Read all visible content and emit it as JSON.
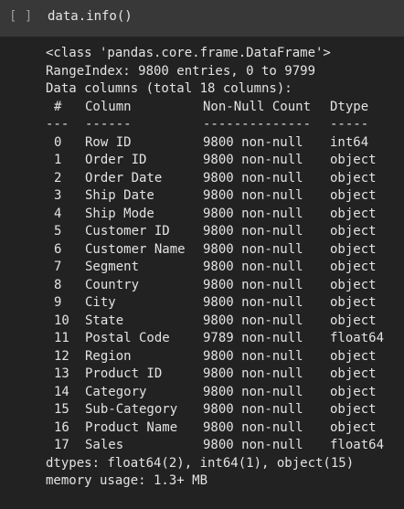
{
  "cell": {
    "prompt": "[ ]",
    "code": "data.info()"
  },
  "output": {
    "class_line": "<class 'pandas.core.frame.DataFrame'>",
    "range_line": "RangeIndex: 9800 entries, 0 to 9799",
    "columns_line": "Data columns (total 18 columns):",
    "header": {
      "num": "#",
      "column": "Column",
      "count": "Non-Null Count",
      "dtype": "Dtype"
    },
    "separator": {
      "num": "---",
      "column": "------",
      "count": "--------------",
      "dtype": "-----"
    },
    "rows": [
      {
        "num": "0",
        "column": "Row ID",
        "count": "9800 non-null",
        "dtype": "int64"
      },
      {
        "num": "1",
        "column": "Order ID",
        "count": "9800 non-null",
        "dtype": "object"
      },
      {
        "num": "2",
        "column": "Order Date",
        "count": "9800 non-null",
        "dtype": "object"
      },
      {
        "num": "3",
        "column": "Ship Date",
        "count": "9800 non-null",
        "dtype": "object"
      },
      {
        "num": "4",
        "column": "Ship Mode",
        "count": "9800 non-null",
        "dtype": "object"
      },
      {
        "num": "5",
        "column": "Customer ID",
        "count": "9800 non-null",
        "dtype": "object"
      },
      {
        "num": "6",
        "column": "Customer Name",
        "count": "9800 non-null",
        "dtype": "object"
      },
      {
        "num": "7",
        "column": "Segment",
        "count": "9800 non-null",
        "dtype": "object"
      },
      {
        "num": "8",
        "column": "Country",
        "count": "9800 non-null",
        "dtype": "object"
      },
      {
        "num": "9",
        "column": "City",
        "count": "9800 non-null",
        "dtype": "object"
      },
      {
        "num": "10",
        "column": "State",
        "count": "9800 non-null",
        "dtype": "object"
      },
      {
        "num": "11",
        "column": "Postal Code",
        "count": "9789 non-null",
        "dtype": "float64"
      },
      {
        "num": "12",
        "column": "Region",
        "count": "9800 non-null",
        "dtype": "object"
      },
      {
        "num": "13",
        "column": "Product ID",
        "count": "9800 non-null",
        "dtype": "object"
      },
      {
        "num": "14",
        "column": "Category",
        "count": "9800 non-null",
        "dtype": "object"
      },
      {
        "num": "15",
        "column": "Sub-Category",
        "count": "9800 non-null",
        "dtype": "object"
      },
      {
        "num": "16",
        "column": "Product Name",
        "count": "9800 non-null",
        "dtype": "object"
      },
      {
        "num": "17",
        "column": "Sales",
        "count": "9800 non-null",
        "dtype": "float64"
      }
    ],
    "dtypes_line": "dtypes: float64(2), int64(1), object(15)",
    "memory_line": "memory usage: 1.3+ MB"
  }
}
